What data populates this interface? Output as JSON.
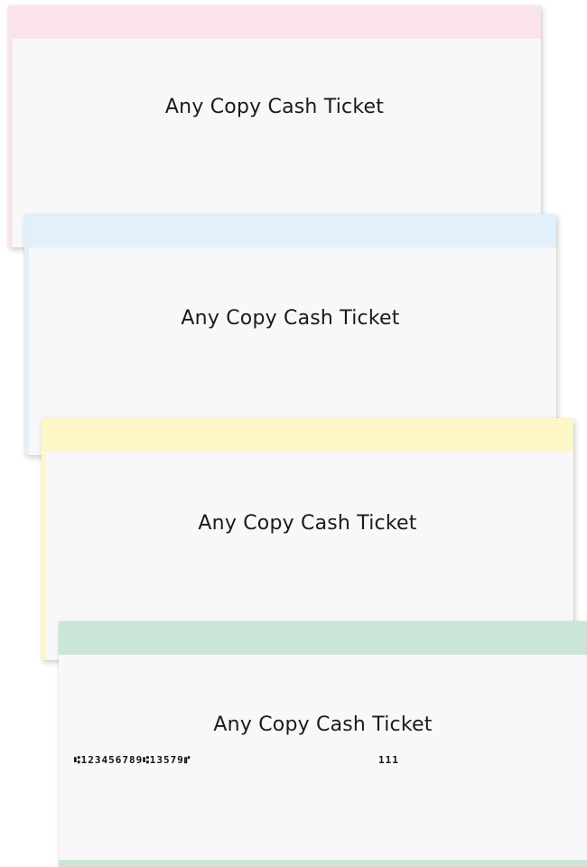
{
  "tickets": [
    {
      "title": "Any Copy Cash Ticket",
      "band_color": "#fbe3ee"
    },
    {
      "title": "Any Copy Cash Ticket",
      "band_color": "#e1f0fa"
    },
    {
      "title": "Any Copy Cash Ticket",
      "band_color": "#fdf6c6"
    },
    {
      "title": "Any Copy Cash Ticket",
      "band_color": "#cbe6d6",
      "micr_line": "⑆123456789⑆13579⑈",
      "micr_aux": "111"
    }
  ]
}
